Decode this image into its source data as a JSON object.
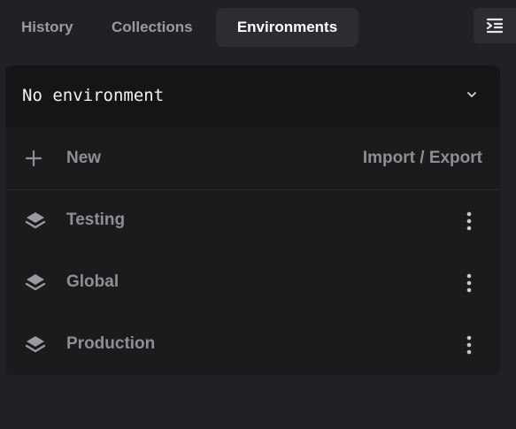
{
  "tabs": [
    {
      "label": "History",
      "active": false
    },
    {
      "label": "Collections",
      "active": false
    },
    {
      "label": "Environments",
      "active": true
    }
  ],
  "menu_toggle": {
    "icon": "indent-menu-icon"
  },
  "environment_selector": {
    "selected": "No environment",
    "icon": "chevron-down-icon"
  },
  "actions": {
    "new_label": "New",
    "new_icon": "plus-icon",
    "import_export_label": "Import / Export"
  },
  "environments": [
    {
      "name": "Testing",
      "icon": "layers-icon",
      "menu_icon": "more-vertical-icon"
    },
    {
      "name": "Global",
      "icon": "layers-icon",
      "menu_icon": "more-vertical-icon"
    },
    {
      "name": "Production",
      "icon": "layers-icon",
      "menu_icon": "more-vertical-icon"
    }
  ],
  "colors": {
    "background": "#202124",
    "panel": "#1b1b1e",
    "selector": "#151517",
    "active_tab": "#2c2d31",
    "muted_text": "#8e8f93",
    "bright_text": "#ffffff"
  }
}
